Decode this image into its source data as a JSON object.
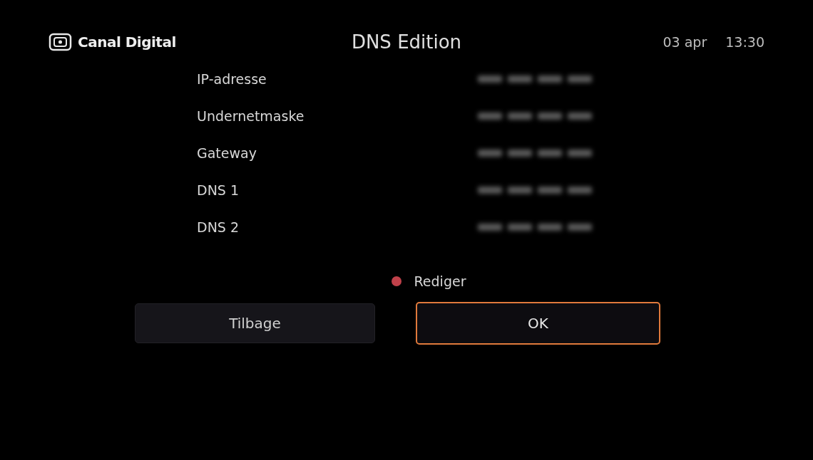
{
  "header": {
    "logo": "Canal Digital",
    "title": "DNS Edition",
    "date": "03 apr",
    "time": "13:30"
  },
  "fields": [
    {
      "label": "IP-adresse"
    },
    {
      "label": "Undernetmaske"
    },
    {
      "label": "Gateway"
    },
    {
      "label": "DNS 1"
    },
    {
      "label": "DNS 2"
    }
  ],
  "hint": {
    "label": "Rediger",
    "color": "#c0414a"
  },
  "buttons": [
    {
      "label": "Tilbage",
      "selected": false
    },
    {
      "label": "OK",
      "selected": true
    }
  ]
}
